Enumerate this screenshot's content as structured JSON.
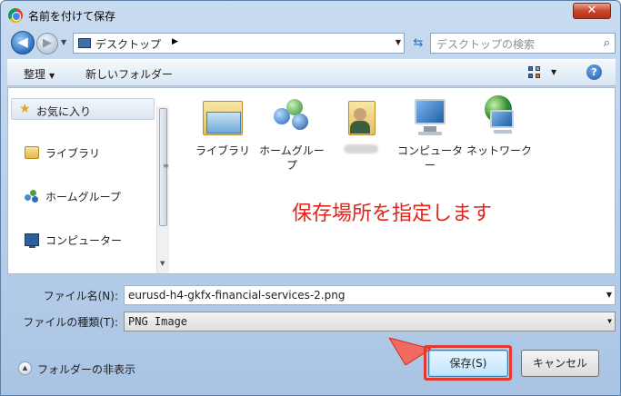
{
  "window": {
    "title": "名前を付けて保存",
    "close_label": "✕"
  },
  "navbar": {
    "back_glyph": "◀",
    "forward_glyph": "▶",
    "address": "デスクトップ",
    "address_arrow": "▶",
    "search_placeholder": "デスクトップの検索"
  },
  "toolbar": {
    "organize": "整理",
    "new_folder": "新しいフォルダー",
    "help": "?"
  },
  "nav_pane": {
    "favorites": "お気に入り",
    "items": [
      {
        "label": "ライブラリ",
        "icon": "library-icon"
      },
      {
        "label": "ホームグループ",
        "icon": "homegroup-icon"
      },
      {
        "label": "コンピューター",
        "icon": "computer-icon"
      }
    ]
  },
  "files": [
    {
      "name": "ライブラリ",
      "icon": "library-folder-icon"
    },
    {
      "name": "ホームグループ",
      "icon": "homegroup-icon"
    },
    {
      "name": "",
      "icon": "user-folder-icon"
    },
    {
      "name": "コンピューター",
      "icon": "computer-icon"
    },
    {
      "name": "ネットワーク",
      "icon": "network-icon"
    }
  ],
  "annotation": "保存場所を指定します",
  "form": {
    "filename_label": "ファイル名(N):",
    "filename_value": "eurusd-h4-gkfx-financial-services-2.png",
    "filetype_label": "ファイルの種類(T):",
    "filetype_value": "PNG Image"
  },
  "footer": {
    "hide_folders": "フォルダーの非表示",
    "save": "保存(S)",
    "cancel": "キャンセル"
  },
  "colors": {
    "accent_red": "#e2251a",
    "window_frame": "#a9c4e4"
  }
}
